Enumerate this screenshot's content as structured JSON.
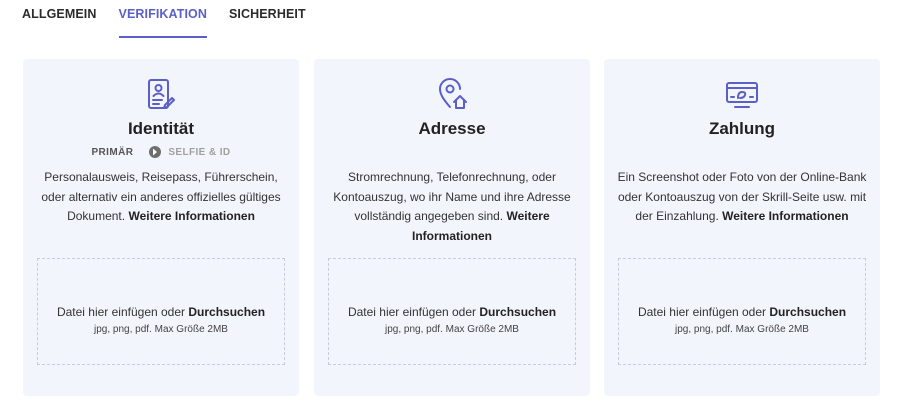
{
  "tabs": [
    {
      "label": "ALLGEMEIN"
    },
    {
      "label": "VERIFIKATION"
    },
    {
      "label": "SICHERHEIT"
    }
  ],
  "accent_color": "#5b5fc7",
  "cards": [
    {
      "icon": "id-document-icon",
      "title": "Identität",
      "steps": {
        "primary": "PRIMÄR",
        "secondary": "SELFIE & ID"
      },
      "desc_text": "Personalausweis, Reisepass, Führerschein, oder alternativ ein anderes offizielles gültiges Dokument.",
      "desc_link": "Weitere Informationen",
      "drop_text": "Datei hier einfügen oder",
      "drop_link": "Durchsuchen",
      "drop_hint": "jpg, png, pdf. Max Größe 2MB"
    },
    {
      "icon": "home-location-icon",
      "title": "Adresse",
      "desc_text": "Stromrechnung, Telefonrechnung, oder Kontoauszug, wo ihr Name und ihre Adresse vollständig angegeben sind.",
      "desc_link": "Weitere Informationen",
      "drop_text": "Datei hier einfügen oder",
      "drop_link": "Durchsuchen",
      "drop_hint": "jpg, png, pdf. Max Größe 2MB"
    },
    {
      "icon": "payment-card-icon",
      "title": "Zahlung",
      "desc_text": "Ein Screenshot oder Foto von der Online-Bank oder Kontoauszug von der Skrill-Seite usw. mit der Einzahlung.",
      "desc_link": "Weitere Informationen",
      "drop_text": "Datei hier einfügen oder",
      "drop_link": "Durchsuchen",
      "drop_hint": "jpg, png, pdf. Max Größe 2MB"
    }
  ]
}
